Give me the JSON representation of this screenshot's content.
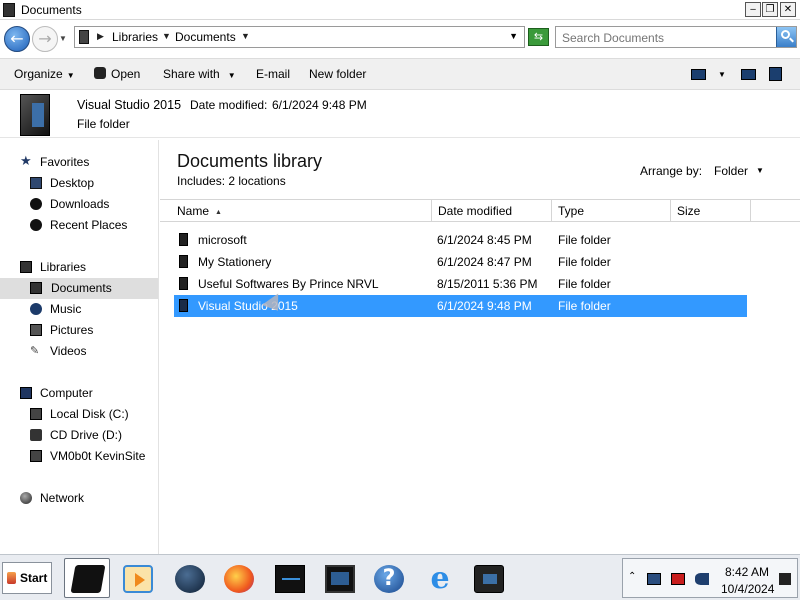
{
  "window": {
    "title": "Documents",
    "minimize_glyph": "‒",
    "maximize_glyph": "❐",
    "close_glyph": "✕"
  },
  "address": {
    "back_glyph": "←",
    "forward_glyph": "→",
    "crumbs": [
      "Libraries",
      "Documents"
    ],
    "refresh_glyph": "⇆",
    "search_placeholder": "Search Documents"
  },
  "toolbar": {
    "organize": "Organize",
    "open": "Open",
    "share_with": "Share with",
    "email": "E-mail",
    "new_folder": "New folder"
  },
  "details": {
    "name": "Visual Studio 2015",
    "date_modified_label": "Date modified:",
    "date_modified_value": "6/1/2024 9:48 PM",
    "type": "File folder"
  },
  "nav": {
    "favorites": "Favorites",
    "desktop": "Desktop",
    "downloads": "Downloads",
    "recent_places": "Recent Places",
    "libraries": "Libraries",
    "documents": "Documents",
    "music": "Music",
    "pictures": "Pictures",
    "videos": "Videos",
    "computer": "Computer",
    "local_disk": "Local Disk (C:)",
    "cd_drive": "CD Drive (D:)",
    "network_location": "VM0b0t KevinSite",
    "network": "Network"
  },
  "content": {
    "title": "Documents library",
    "subtitle": "Includes:  2 locations",
    "arrange_by_label": "Arrange by:",
    "arrange_by_value": "Folder",
    "columns": {
      "name": "Name",
      "date_modified": "Date modified",
      "type": "Type",
      "size": "Size"
    },
    "rows": [
      {
        "name": "microsoft",
        "date": "6/1/2024 8:45 PM",
        "type": "File folder"
      },
      {
        "name": "My Stationery",
        "date": "6/1/2024 8:47 PM",
        "type": "File folder"
      },
      {
        "name": "Useful Softwares By Prince NRVL",
        "date": "8/15/2011 5:36 PM",
        "type": "File folder"
      },
      {
        "name": "Visual Studio 2015",
        "date": "6/1/2024 9:48 PM",
        "type": "File folder",
        "selected": true
      }
    ]
  },
  "taskbar": {
    "start": "Start",
    "help_glyph": "?",
    "ie_glyph": "e",
    "tray_chevron": "⌃",
    "time": "8:42 AM",
    "date": "10/4/2024"
  },
  "colors": {
    "selection": "#3399ff",
    "nav_selected": "#dedede",
    "toolbar_bg": "#f0f0f0"
  }
}
